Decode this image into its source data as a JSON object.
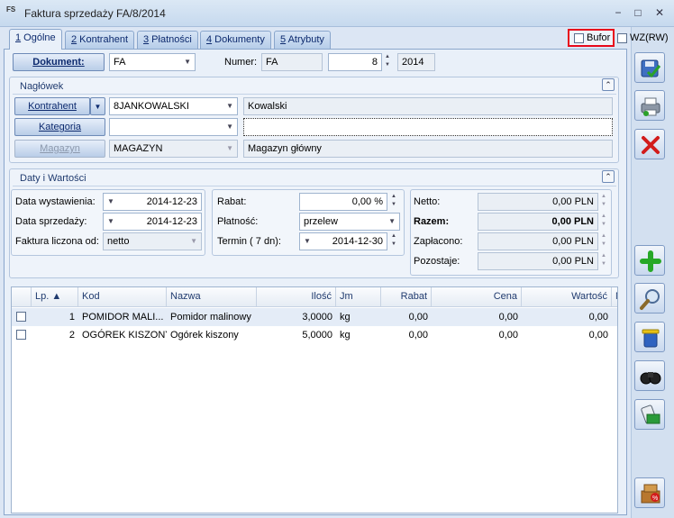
{
  "window": {
    "icon": "FS",
    "title": "Faktura sprzedaży FA/8/2014",
    "controls": [
      "−",
      "□",
      "✕"
    ]
  },
  "tabs": [
    {
      "num": "1",
      "label": " Ogólne"
    },
    {
      "num": "2",
      "label": " Kontrahent"
    },
    {
      "num": "3",
      "label": " Płatności"
    },
    {
      "num": "4",
      "label": " Dokumenty"
    },
    {
      "num": "5",
      "label": " Atrybuty"
    }
  ],
  "flags": {
    "bufor": "Bufor",
    "wz": "WZ(RW)"
  },
  "document": {
    "button": "Dokument:",
    "type": "FA",
    "number_label": "Numer:",
    "number_prefix": "FA",
    "number": "8",
    "year": "2014"
  },
  "header_section": {
    "title": "Nagłówek",
    "kontrahent_button": "Kontrahent",
    "kontrahent_code": "8JANKOWALSKI",
    "kontrahent_name": "Kowalski",
    "kategoria_button": "Kategoria",
    "kategoria_value": "",
    "kategoria_desc": "",
    "magazyn_button": "Magazyn",
    "magazyn_code": "MAGAZYN",
    "magazyn_name": "Magazyn główny"
  },
  "dates_section": {
    "title": "Daty i Wartości",
    "data_wyst_label": "Data wystawienia:",
    "data_wyst": "2014-12-23",
    "data_sprz_label": "Data sprzedaży:",
    "data_sprz": "2014-12-23",
    "liczona_label": "Faktura liczona od:",
    "liczona": "netto",
    "rabat_label": "Rabat:",
    "rabat": "0,00 %",
    "platnosc_label": "Płatność:",
    "platnosc": "przelew",
    "termin_label": "Termin  (   7 dn):",
    "termin": "2014-12-30",
    "netto_label": "Netto:",
    "netto": "0,00 PLN",
    "razem_label": "Razem:",
    "razem": "0,00 PLN",
    "zaplacono_label": "Zapłacono:",
    "zaplacono": "0,00 PLN",
    "pozostaje_label": "Pozostaje:",
    "pozostaje": "0,00 PLN"
  },
  "grid": {
    "columns": [
      "Lp. ▲",
      "Kod",
      "Nazwa",
      "Ilość",
      "Jm",
      "Rabat",
      "Cena",
      "Wartość",
      "Ma"
    ],
    "rows": [
      {
        "lp": "1",
        "kod": "POMIDOR MALI...",
        "nazwa": "Pomidor malinowy",
        "ilosc": "3,0000",
        "jm": "kg",
        "rabat": "0,00",
        "cena": "0,00",
        "wartosc": "0,00"
      },
      {
        "lp": "2",
        "kod": "OGÓREK KISZONY",
        "nazwa": "Ogórek kiszony",
        "ilosc": "5,0000",
        "jm": "kg",
        "rabat": "0,00",
        "cena": "0,00",
        "wartosc": "0,00"
      }
    ]
  },
  "toolbar_icons": [
    "save-icon",
    "print-icon",
    "cancel-icon",
    "add-icon",
    "edit-icon",
    "delete-icon",
    "find-icon",
    "payment-icon",
    "discount-icon"
  ],
  "colors": {
    "highlight": "#e8091b",
    "delete": "#d21c1c",
    "add": "#27a827"
  }
}
